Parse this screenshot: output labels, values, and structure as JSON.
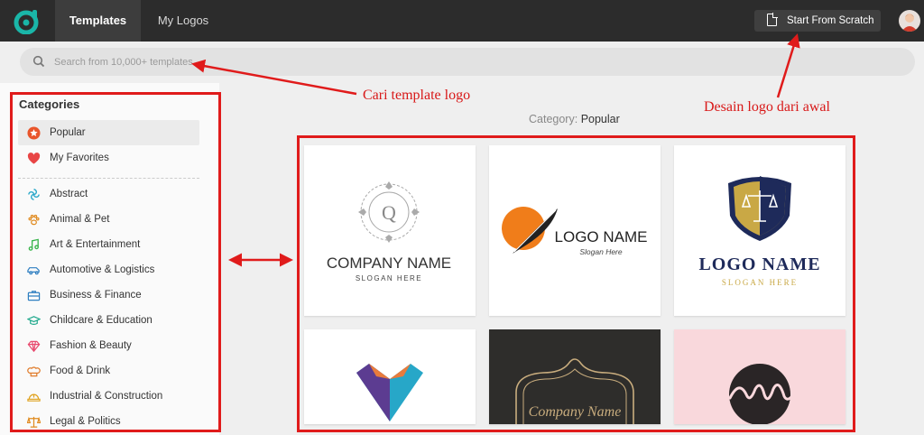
{
  "header": {
    "tabs": [
      {
        "label": "Templates"
      },
      {
        "label": "My Logos"
      }
    ],
    "scratch_button": "Start From Scratch"
  },
  "search": {
    "placeholder": "Search from 10,000+ templates..."
  },
  "sidebar": {
    "title": "Categories",
    "items": [
      {
        "label": "Popular",
        "icon": "star-icon",
        "color": "#e9552b"
      },
      {
        "label": "My Favorites",
        "icon": "heart-icon",
        "color": "#e84545"
      },
      {
        "label": "Abstract",
        "icon": "abstract-icon",
        "color": "#29a8c9"
      },
      {
        "label": "Animal & Pet",
        "icon": "paw-icon",
        "color": "#e08a1e"
      },
      {
        "label": "Art & Entertainment",
        "icon": "music-note-icon",
        "color": "#38b44a"
      },
      {
        "label": "Automotive & Logistics",
        "icon": "car-icon",
        "color": "#2f7fc1"
      },
      {
        "label": "Business & Finance",
        "icon": "briefcase-icon",
        "color": "#2f7fc1"
      },
      {
        "label": "Childcare & Education",
        "icon": "graduation-cap-icon",
        "color": "#1fa98c"
      },
      {
        "label": "Fashion & Beauty",
        "icon": "diamond-icon",
        "color": "#e84a6f"
      },
      {
        "label": "Food & Drink",
        "icon": "chef-hat-icon",
        "color": "#e07b2a"
      },
      {
        "label": "Industrial & Construction",
        "icon": "hard-hat-icon",
        "color": "#e0a21e"
      },
      {
        "label": "Legal & Politics",
        "icon": "scales-icon",
        "color": "#e08a1e"
      }
    ]
  },
  "main": {
    "category_prefix": "Category:",
    "category_name": "Popular",
    "templates": [
      {
        "company": "COMPANY NAME",
        "slogan": "SLOGAN HERE",
        "monogram": "Q"
      },
      {
        "logo_name": "LOGO NAME",
        "slogan": "Slogan Here"
      },
      {
        "logo_name": "LOGO NAME",
        "slogan": "SLOGAN HERE"
      },
      {},
      {
        "script": "Company Name"
      },
      {}
    ]
  },
  "annotations": {
    "search": "Cari template logo",
    "scratch": "Desain logo dari awal"
  },
  "colors": {
    "accent_red": "#e01b1b",
    "topbar": "#2c2c2c"
  }
}
